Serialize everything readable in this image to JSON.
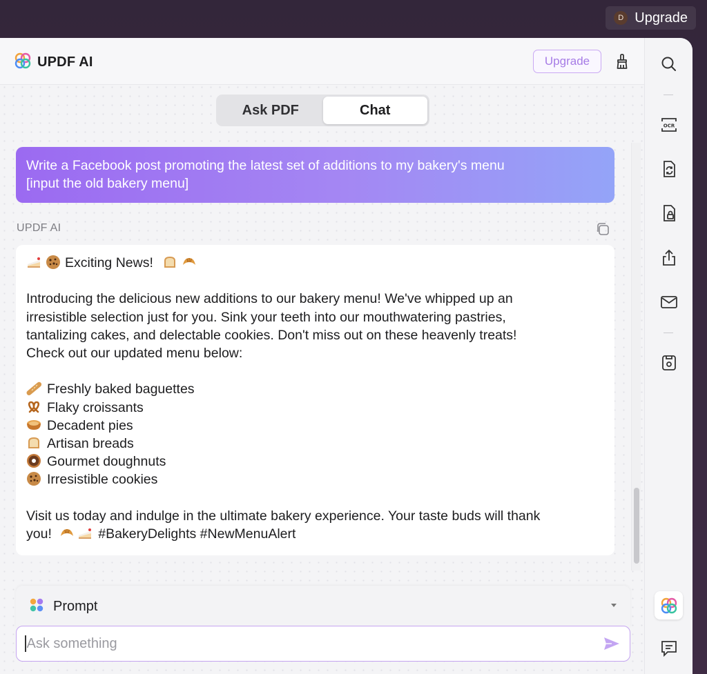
{
  "topbar": {
    "avatar_initial": "D",
    "upgrade_label": "Upgrade"
  },
  "header": {
    "brand": "UPDF AI",
    "upgrade_label": "Upgrade"
  },
  "tabs": [
    {
      "label": "Ask PDF",
      "active": false
    },
    {
      "label": "Chat",
      "active": true
    }
  ],
  "user_message": {
    "line1": "Write a Facebook post promoting the latest set of additions to my bakery's menu",
    "line2": "[input the old bakery menu]"
  },
  "ai_label": "UPDF AI",
  "ai_message": {
    "headline": "Exciting News!",
    "intro": [
      "Introducing the delicious new additions to our bakery menu! We've whipped up an",
      "irresistible selection just for you. Sink your teeth into our mouthwatering pastries,",
      "tantalizing cakes, and delectable cookies. Don't miss out on these heavenly treats!",
      "Check out our updated menu below:"
    ],
    "items": [
      {
        "icon": "baguette-icon",
        "text": "Freshly baked baguettes"
      },
      {
        "icon": "pretzel-icon",
        "text": "Flaky croissants"
      },
      {
        "icon": "pie-icon",
        "text": "Decadent pies"
      },
      {
        "icon": "bread-icon",
        "text": "Artisan breads"
      },
      {
        "icon": "doughnut-icon",
        "text": "Gourmet doughnuts"
      },
      {
        "icon": "cookie-icon",
        "text": "Irresistible cookies"
      }
    ],
    "closing_line1": "Visit us today and indulge in the ultimate bakery experience. Your taste buds will thank",
    "closing_line2": "you!",
    "hashtags": "#BakeryDelights #NewMenuAlert"
  },
  "prompt": {
    "label": "Prompt"
  },
  "input": {
    "placeholder": "Ask something",
    "value": ""
  },
  "rail_icons": [
    "search-icon",
    "ocr-icon",
    "convert-icon",
    "protect-icon",
    "share-icon",
    "mail-icon",
    "save-icon",
    "updf-ai-icon",
    "comment-icon"
  ],
  "colors": {
    "accent": "#a67be6",
    "user_bubble_start": "#9b6af1",
    "user_bubble_end": "#94a4f8"
  }
}
